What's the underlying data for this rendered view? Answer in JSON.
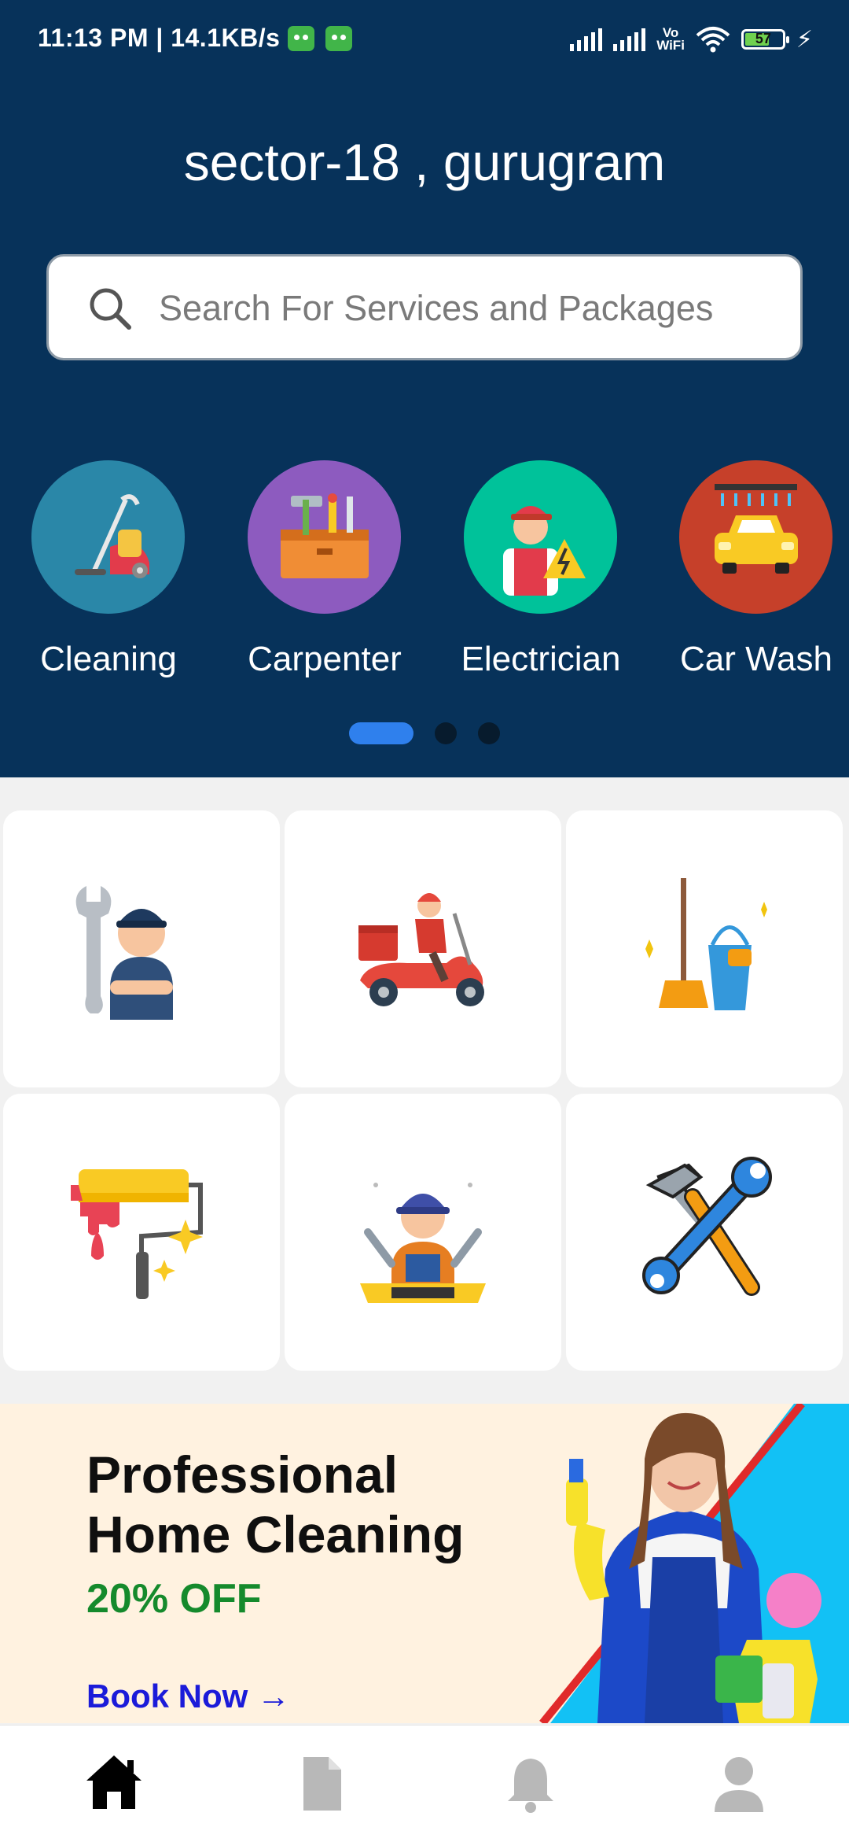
{
  "status": {
    "time": "11:13 PM | 14.1KB/s",
    "vowifi_top": "Vo",
    "vowifi_bottom": "WiFi",
    "battery": "57"
  },
  "location": "sector-18 , gurugram",
  "search": {
    "placeholder": "Search For Services and Packages"
  },
  "categories": [
    {
      "label": "Cleaning",
      "color": "#2a87a8",
      "icon": "vacuum-cleaner-icon"
    },
    {
      "label": "Carpenter",
      "color": "#8d5bbf",
      "icon": "toolbox-icon"
    },
    {
      "label": "Electrician",
      "color": "#00c29a",
      "icon": "electrician-icon"
    },
    {
      "label": "Car Wash",
      "color": "#c6402a",
      "icon": "car-wash-icon"
    }
  ],
  "carousel": {
    "pages": 3,
    "active": 0
  },
  "service_tiles": [
    {
      "icon": "mechanic-icon"
    },
    {
      "icon": "delivery-scooter-icon"
    },
    {
      "icon": "broom-bucket-icon"
    },
    {
      "icon": "paint-roller-icon"
    },
    {
      "icon": "plumber-icon"
    },
    {
      "icon": "hammer-wrench-icon"
    }
  ],
  "banner": {
    "title_line1": "Professional",
    "title_line2": "Home Cleaning",
    "offer": "20% OFF",
    "cta": "Book Now →"
  },
  "bottom_nav": [
    {
      "icon": "home-icon",
      "active": true
    },
    {
      "icon": "document-icon",
      "active": false
    },
    {
      "icon": "bell-icon",
      "active": false
    },
    {
      "icon": "profile-icon",
      "active": false
    }
  ],
  "colors": {
    "header_bg": "#07325a",
    "accent": "#2f80ed",
    "offer_green": "#158a2c",
    "cta_blue": "#1b1bd9"
  }
}
